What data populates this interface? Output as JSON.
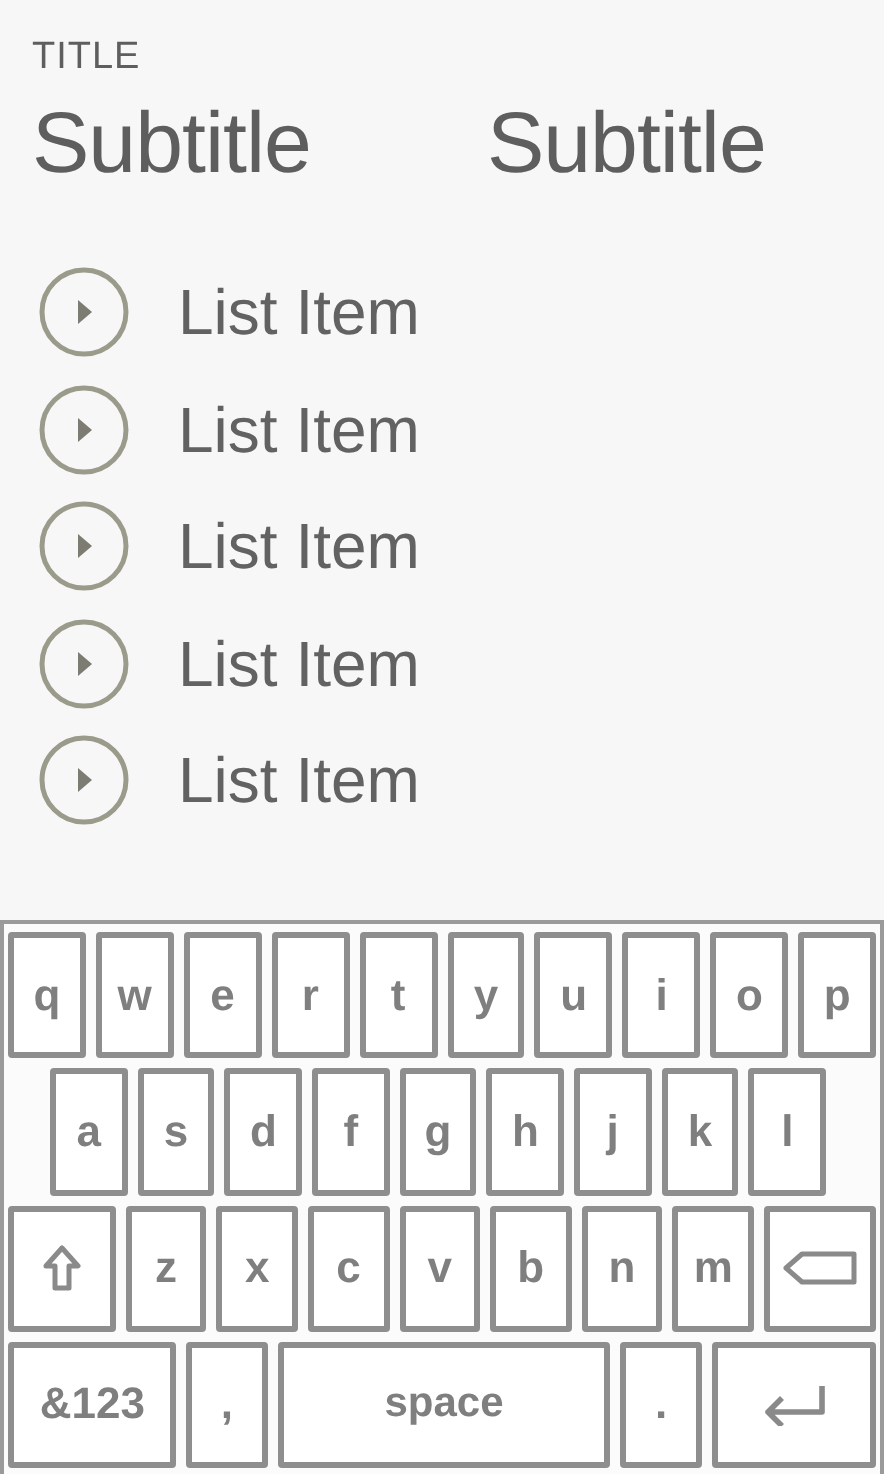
{
  "header": {
    "title": "TITLE",
    "subtitles": [
      "Subtitle",
      "Subtitle"
    ]
  },
  "list": [
    {
      "label": "List Item"
    },
    {
      "label": "List Item"
    },
    {
      "label": "List Item"
    },
    {
      "label": "List Item"
    },
    {
      "label": "List Item"
    }
  ],
  "keyboard": {
    "rows": [
      {
        "indented": false,
        "keys": [
          {
            "kind": "letter",
            "label": "q"
          },
          {
            "kind": "letter",
            "label": "w"
          },
          {
            "kind": "letter",
            "label": "e"
          },
          {
            "kind": "letter",
            "label": "r"
          },
          {
            "kind": "letter",
            "label": "t"
          },
          {
            "kind": "letter",
            "label": "y"
          },
          {
            "kind": "letter",
            "label": "u"
          },
          {
            "kind": "letter",
            "label": "i"
          },
          {
            "kind": "letter",
            "label": "o"
          },
          {
            "kind": "letter",
            "label": "p"
          }
        ]
      },
      {
        "indented": true,
        "keys": [
          {
            "kind": "letter",
            "label": "a"
          },
          {
            "kind": "letter",
            "label": "s"
          },
          {
            "kind": "letter",
            "label": "d"
          },
          {
            "kind": "letter",
            "label": "f"
          },
          {
            "kind": "letter",
            "label": "g"
          },
          {
            "kind": "letter",
            "label": "h"
          },
          {
            "kind": "letter",
            "label": "j"
          },
          {
            "kind": "letter",
            "label": "k"
          },
          {
            "kind": "letter",
            "label": "l"
          }
        ]
      },
      {
        "indented": false,
        "keys": [
          {
            "kind": "shift"
          },
          {
            "kind": "letter",
            "label": "z"
          },
          {
            "kind": "letter",
            "label": "x"
          },
          {
            "kind": "letter",
            "label": "c"
          },
          {
            "kind": "letter",
            "label": "v"
          },
          {
            "kind": "letter",
            "label": "b"
          },
          {
            "kind": "letter",
            "label": "n"
          },
          {
            "kind": "letter",
            "label": "m"
          },
          {
            "kind": "backspace"
          }
        ]
      },
      {
        "indented": false,
        "keys": [
          {
            "kind": "symbols",
            "label": "&123"
          },
          {
            "kind": "punct",
            "label": ","
          },
          {
            "kind": "space",
            "label": "space"
          },
          {
            "kind": "punct",
            "label": "."
          },
          {
            "kind": "enter"
          }
        ]
      }
    ]
  }
}
